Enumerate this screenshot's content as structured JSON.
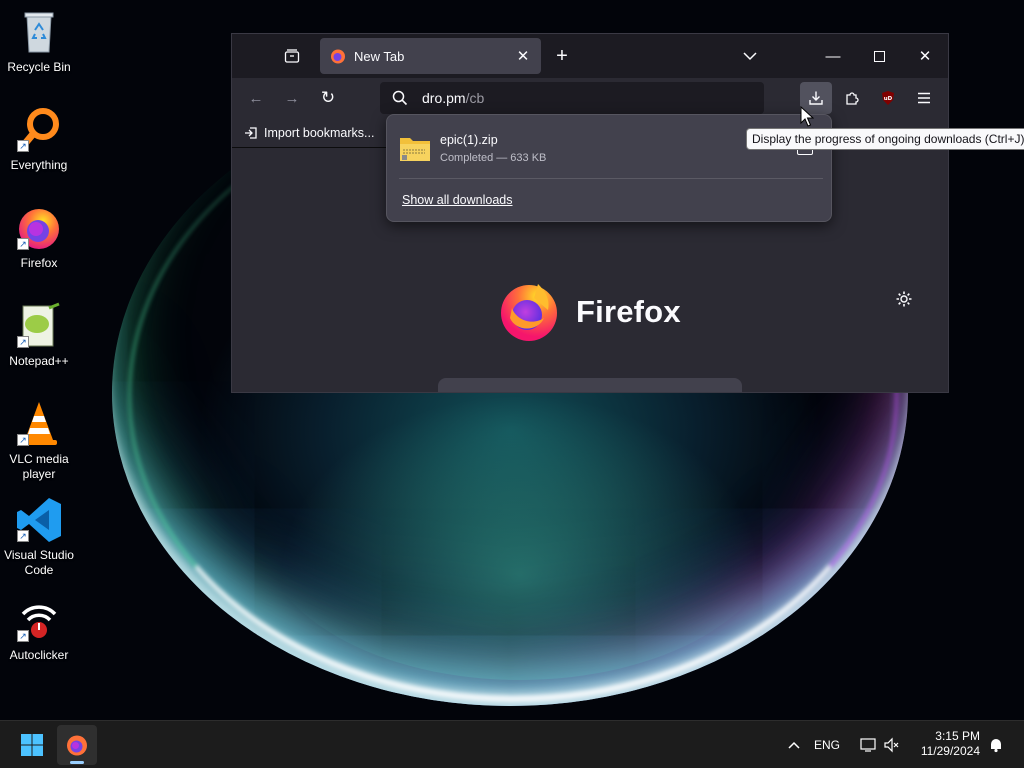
{
  "desktop": {
    "icons": [
      {
        "label": "Recycle Bin",
        "icon": "recycle-bin-icon"
      },
      {
        "label": "Everything",
        "icon": "everything-search-icon"
      },
      {
        "label": "Firefox",
        "icon": "firefox-icon"
      },
      {
        "label": "Notepad++",
        "icon": "notepad-plus-plus-icon"
      },
      {
        "label_line1": "VLC media",
        "label_line2": "player",
        "icon": "vlc-cone-icon"
      },
      {
        "label_line1": "Visual Studio",
        "label_line2": "Code",
        "icon": "vscode-icon"
      },
      {
        "label": "Autoclicker",
        "icon": "autoclicker-icon"
      }
    ]
  },
  "browser": {
    "tab": {
      "title": "New Tab"
    },
    "urlbar": {
      "host": "dro.pm",
      "path": "/cb"
    },
    "bookmarks": {
      "import_label": "Import bookmarks..."
    },
    "newtab": {
      "wordmark": "Firefox"
    },
    "colors": {
      "frame": "#1c1b22",
      "toolbar": "#2b2a33",
      "tab_active": "#42414d",
      "accent": "#ff7139"
    }
  },
  "downloads_panel": {
    "item": {
      "filename": "epic(1).zip",
      "status": "Completed — 633 KB"
    },
    "show_all_label": "Show all downloads"
  },
  "tooltip": {
    "text": "Display the progress of ongoing downloads (Ctrl+J)"
  },
  "taskbar": {
    "language": "ENG",
    "time": "3:15 PM",
    "date": "11/29/2024"
  }
}
